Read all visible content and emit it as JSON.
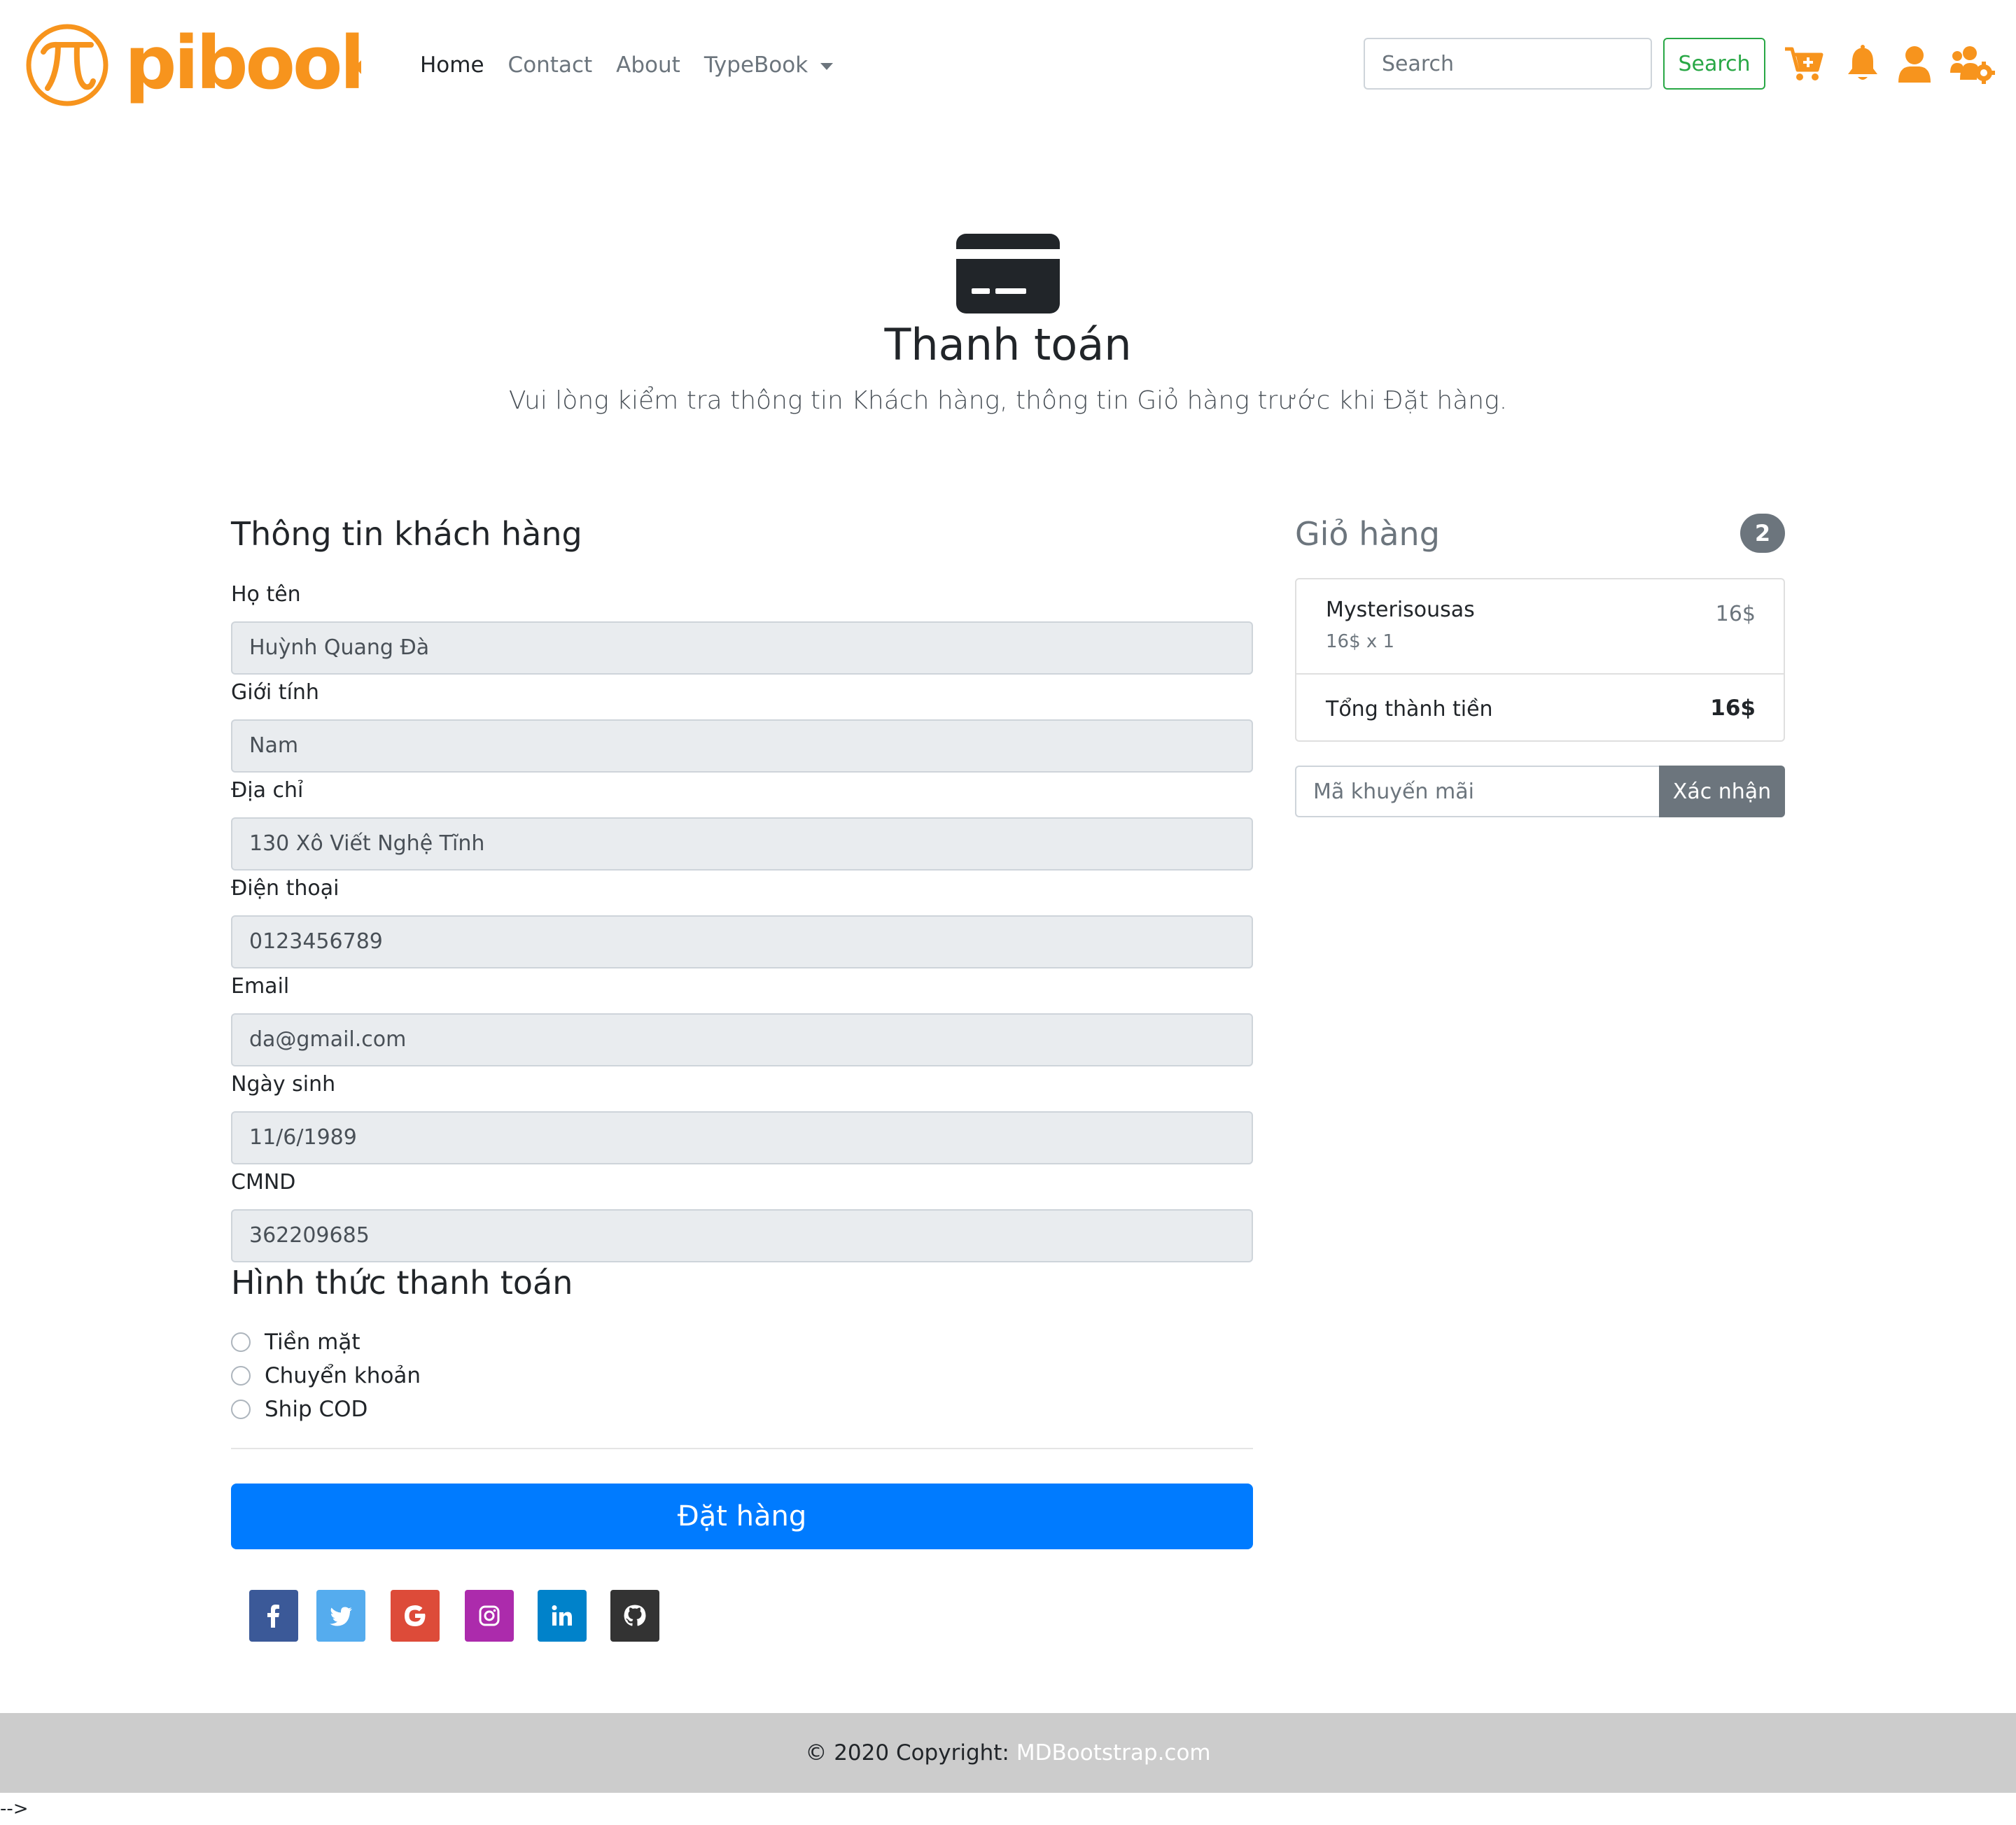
{
  "brand": {
    "name": "pibook",
    "color": "#f7941d"
  },
  "nav": {
    "links": [
      {
        "label": "Home",
        "active": true
      },
      {
        "label": "Contact"
      },
      {
        "label": "About"
      },
      {
        "label": "TypeBook"
      }
    ],
    "search_placeholder": "Search",
    "search_button": "Search",
    "icons": [
      "cart-plus-icon",
      "bell-icon",
      "user-icon",
      "users-cog-icon"
    ]
  },
  "hero": {
    "icon": "credit-card-icon",
    "title": "Thanh toán",
    "lead": "Vui lòng kiểm tra thông tin Khách hàng, thông tin Giỏ hàng trước khi Đặt hàng."
  },
  "customer": {
    "title": "Thông tin khách hàng",
    "fields": [
      {
        "label": "Họ tên",
        "value": "Huỳnh Quang Đà"
      },
      {
        "label": "Giới tính",
        "value": "Nam"
      },
      {
        "label": "Địa chỉ",
        "value": "130 Xô Viết Nghệ Tĩnh"
      },
      {
        "label": "Điện thoại",
        "value": "0123456789"
      },
      {
        "label": "Email",
        "value": "da@gmail.com"
      },
      {
        "label": "Ngày sinh",
        "value": "11/6/1989"
      },
      {
        "label": "CMND",
        "value": "362209685"
      }
    ]
  },
  "payment": {
    "title": "Hình thức thanh toán",
    "options": [
      "Tiền mặt",
      "Chuyển khoản",
      "Ship COD"
    ],
    "submit": "Đặt hàng"
  },
  "social": [
    {
      "name": "facebook",
      "color": "#3b5998"
    },
    {
      "name": "twitter",
      "color": "#55acee"
    },
    {
      "name": "google",
      "color": "#dd4b39"
    },
    {
      "name": "instagram",
      "color": "#ac2bac"
    },
    {
      "name": "linkedin",
      "color": "#0082ca"
    },
    {
      "name": "github",
      "color": "#333333"
    }
  ],
  "cart": {
    "title": "Giỏ hàng",
    "count": "2",
    "items": [
      {
        "name": "Mysterisousas",
        "detail": "16$ x 1",
        "price": "16$"
      }
    ],
    "total_label": "Tổng thành tiền",
    "total_value": "16$",
    "promo_placeholder": "Mã khuyến mãi",
    "promo_button": "Xác nhận"
  },
  "footer": {
    "copyright": "© 2020 Copyright:",
    "link": "MDBootstrap.com"
  },
  "stray_text": "-->"
}
